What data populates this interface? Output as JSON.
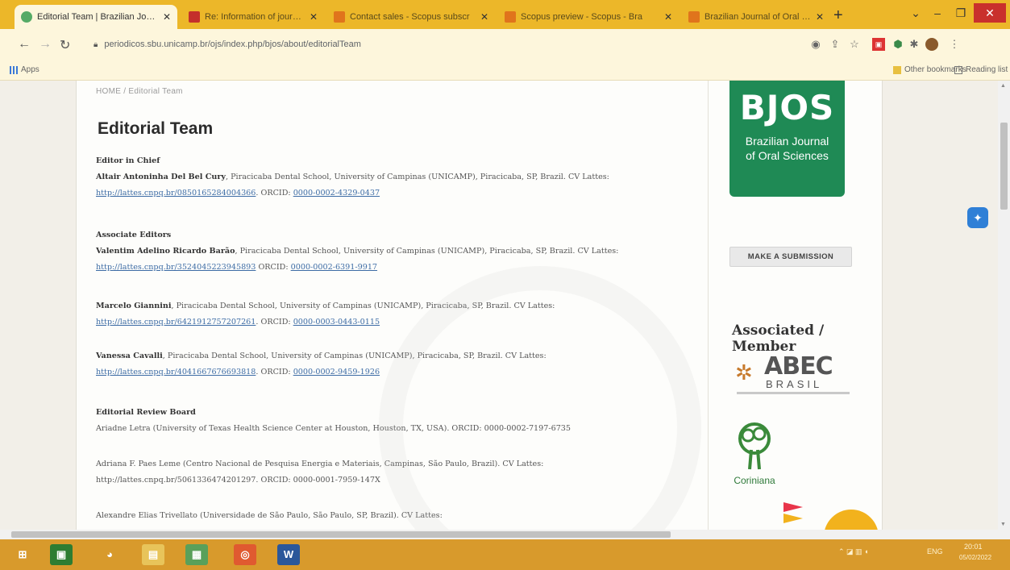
{
  "browser": {
    "tabs": [
      {
        "title": "Editorial Team | Brazilian Journ",
        "active": true,
        "color": "#4a7"
      },
      {
        "title": "Re: Information of journal inci",
        "active": false,
        "color": "#c4302b"
      },
      {
        "title": "Contact sales - Scopus subscr",
        "active": false,
        "color": "#e8a210"
      },
      {
        "title": "Scopus preview - Scopus - Bra",
        "active": false,
        "color": "#e8a210"
      },
      {
        "title": "Brazilian Journal of Oral Scien",
        "active": false,
        "color": "#e8a210"
      }
    ],
    "new_tab": "+",
    "url": "periodicos.sbu.unicamp.br/ojs/index.php/bjos/about/editorialTeam",
    "bookmarks": {
      "apps": "Apps",
      "other": "Other bookmarks",
      "reading": "Reading list"
    }
  },
  "page": {
    "breadcrumb": "HOME / Editorial Team",
    "title": "Editorial Team",
    "editor_in_chief": {
      "heading": "Editor in Chief",
      "name": "Altair Antoninha Del Bel Cury",
      "affil": ", Piracicaba Dental School, University of Campinas (UNICAMP), Piracicaba, SP, Brazil. CV Lattes: ",
      "lattes": "http://lattes.cnpq.br/0850165284004366",
      "orcid_label": ". ORCID: ",
      "orcid": "0000-0002-4329-0437"
    },
    "associate": {
      "heading": "Associate Editors",
      "people": [
        {
          "name": "Valentim Adelino Ricardo Barão",
          "affil": ", Piracicaba Dental School, University of Campinas (UNICAMP), Piracicaba, SP, Brazil. CV Lattes: ",
          "lattes": "http://lattes.cnpq.br/3524045223945893",
          "orcid_label": " ORCID: ",
          "orcid": "0000-0002-6391-9917"
        },
        {
          "name": "Marcelo Giannini",
          "affil": ", Piracicaba Dental School, University of Campinas (UNICAMP), Piracicaba, SP, Brazil. CV Lattes: ",
          "lattes": "http://lattes.cnpq.br/6421912757207261",
          "orcid_label": ". ORCID: ",
          "orcid": "0000-0003-0443-0115"
        },
        {
          "name": "Vanessa Cavalli",
          "affil": ", Piracicaba Dental School, University of Campinas (UNICAMP), Piracicaba, SP, Brazil. CV Lattes: ",
          "lattes": "http://lattes.cnpq.br/4041667676693818",
          "orcid_label": ". ORCID: ",
          "orcid": "0000-0002-9459-1926"
        }
      ]
    },
    "review_board": {
      "heading": "Editorial Review Board",
      "entries": [
        "Ariadne Letra (University of Texas Health Science Center at Houston, Houston, TX, USA). ORCID: 0000-0002-7197-6735",
        "Adriana F. Paes Leme (Centro Nacional de Pesquisa Energia e Materiais, Campinas, São Paulo, Brazil). CV Lattes: http://lattes.cnpq.br/5061336474201297. ORCID: 0000-0001-7959-147X",
        "Alexandre Elias Trivellato (Universidade de São Paulo, São Paulo, SP, Brazil). CV Lattes:"
      ]
    }
  },
  "sidebar": {
    "logo_big": "BJOS",
    "logo_line1": "Brazilian Journal",
    "logo_line2": "of Oral Sciences",
    "submit_label": "MAKE A SUBMISSION",
    "assoc_title": "Associated / Member",
    "abec_word": "ABEC",
    "abec_sub": "BRASIL",
    "cori_label": "Coriniana"
  },
  "taskbar": {
    "time": "20:01",
    "date": "05/02/2022"
  }
}
